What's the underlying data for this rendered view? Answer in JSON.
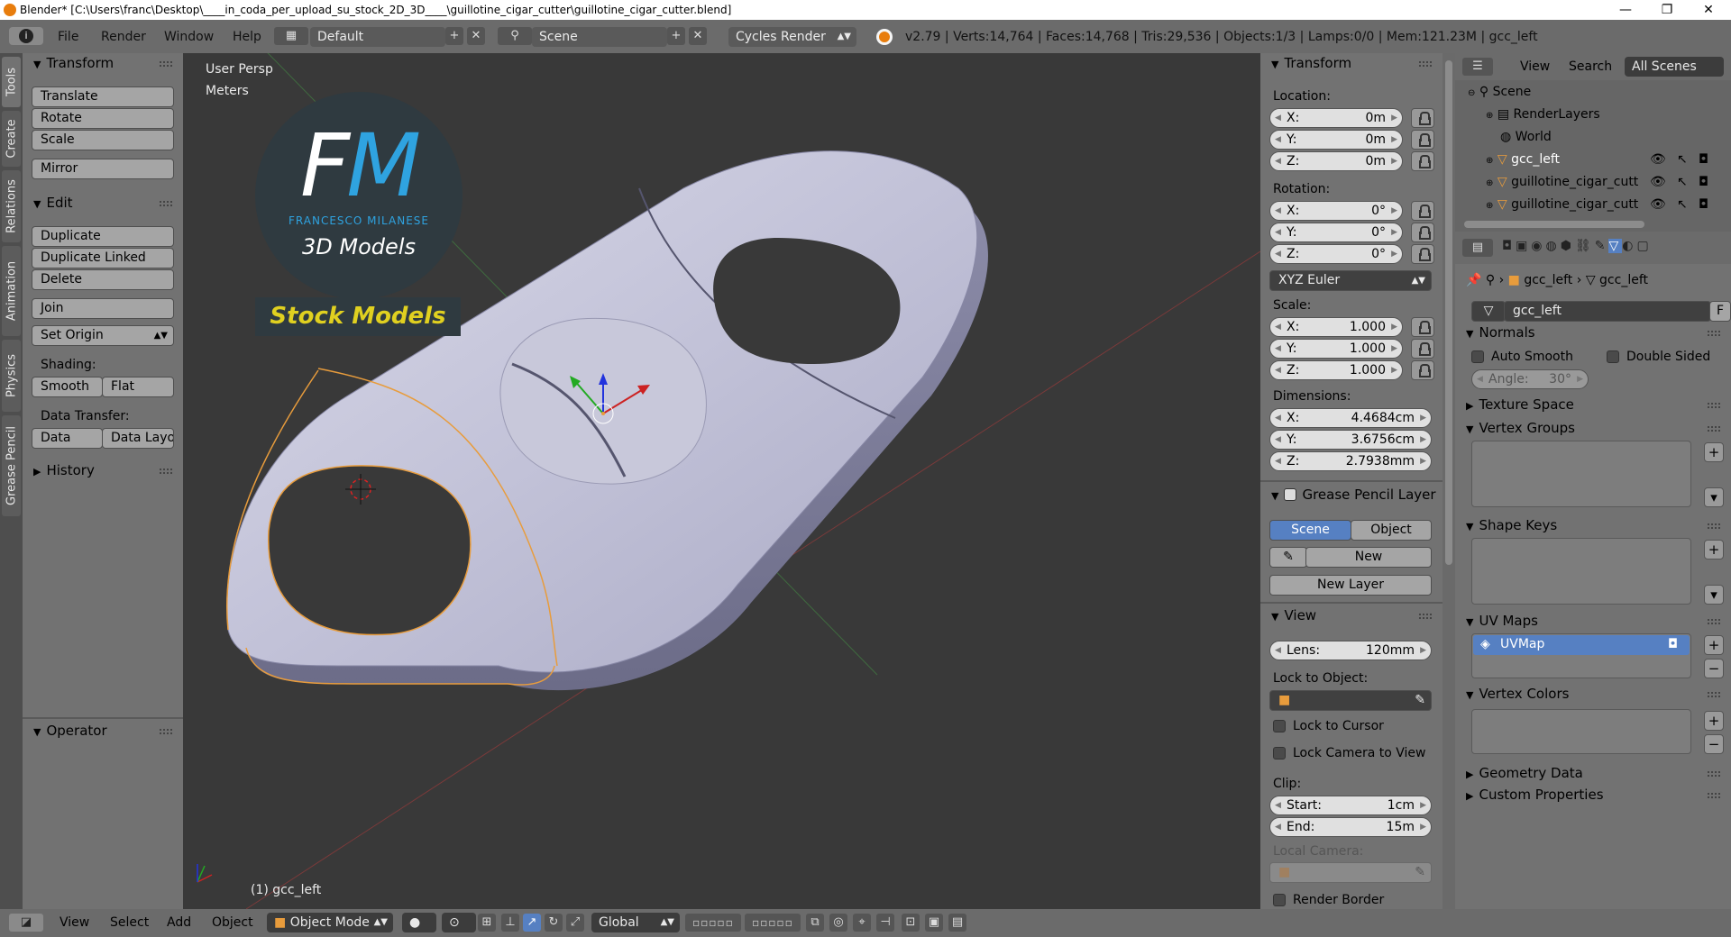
{
  "titlebar": {
    "title": "Blender* [C:\\Users\\franc\\Desktop\\____in_coda_per_upload_su_stock_2D_3D____\\guillotine_cigar_cutter\\guillotine_cigar_cutter.blend]",
    "minimize": "—",
    "maximize": "❐",
    "close": "✕"
  },
  "menubar": {
    "info_icon": "i",
    "file": "File",
    "render": "Render",
    "window": "Window",
    "help": "Help",
    "screen_layout": "Default",
    "scene": "Scene",
    "engine": "Cycles Render",
    "stats": "v2.79 | Verts:14,764 | Faces:14,768 | Tris:29,536 | Objects:1/3 | Lamps:0/0 | Mem:121.23M | gcc_left"
  },
  "tabs": [
    "Tools",
    "Create",
    "Relations",
    "Animation",
    "Physics",
    "Grease Pencil"
  ],
  "toolshelf": {
    "transform_title": "Transform",
    "translate": "Translate",
    "rotate": "Rotate",
    "scale": "Scale",
    "mirror": "Mirror",
    "edit_title": "Edit",
    "duplicate": "Duplicate",
    "duplicate_linked": "Duplicate Linked",
    "delete": "Delete",
    "join": "Join",
    "set_origin": "Set Origin",
    "shading_label": "Shading:",
    "smooth": "Smooth",
    "flat": "Flat",
    "data_transfer_label": "Data Transfer:",
    "data": "Data",
    "data_layout": "Data Layo",
    "history_title": "History",
    "operator_title": "Operator"
  },
  "viewport": {
    "view_name": "User Persp",
    "units": "Meters",
    "object_label": "(1) gcc_left",
    "logo_letters": "FM",
    "logo_name": "FRANCESCO MILANESE",
    "logo_sub": "3D Models",
    "stock_models": "Stock Models"
  },
  "npanel": {
    "transform_title": "Transform",
    "location_label": "Location:",
    "location": [
      {
        "k": "X:",
        "v": "0m"
      },
      {
        "k": "Y:",
        "v": "0m"
      },
      {
        "k": "Z:",
        "v": "0m"
      }
    ],
    "rotation_label": "Rotation:",
    "rotation": [
      {
        "k": "X:",
        "v": "0°"
      },
      {
        "k": "Y:",
        "v": "0°"
      },
      {
        "k": "Z:",
        "v": "0°"
      }
    ],
    "rotation_mode": "XYZ Euler",
    "scale_label": "Scale:",
    "scale": [
      {
        "k": "X:",
        "v": "1.000"
      },
      {
        "k": "Y:",
        "v": "1.000"
      },
      {
        "k": "Z:",
        "v": "1.000"
      }
    ],
    "dimensions_label": "Dimensions:",
    "dimensions": [
      {
        "k": "X:",
        "v": "4.4684cm"
      },
      {
        "k": "Y:",
        "v": "3.6756cm"
      },
      {
        "k": "Z:",
        "v": "2.7938mm"
      }
    ],
    "grease_title": "Grease Pencil Layer",
    "scene_btn": "Scene",
    "object_btn": "Object",
    "new_btn": "New",
    "new_layer_btn": "New Layer",
    "view_title": "View",
    "lens_key": "Lens:",
    "lens_val": "120mm",
    "lock_to_object": "Lock to Object:",
    "lock_to_cursor": "Lock to Cursor",
    "lock_camera": "Lock Camera to View",
    "clip_label": "Clip:",
    "clip_start_key": "Start:",
    "clip_start_val": "1cm",
    "clip_end_key": "End:",
    "clip_end_val": "15m",
    "local_camera": "Local Camera:",
    "render_border": "Render Border"
  },
  "outliner": {
    "view": "View",
    "search": "Search",
    "all_scenes": "All Scenes",
    "items": [
      "Scene",
      "RenderLayers",
      "World",
      "gcc_left",
      "guillotine_cigar_cutt",
      "guillotine_cigar_cutt"
    ]
  },
  "props": {
    "breadcrumb_obj": "gcc_left",
    "breadcrumb_mesh": "gcc_left",
    "mesh_name": "gcc_left",
    "fake_user": "F",
    "normals_title": "Normals",
    "auto_smooth": "Auto Smooth",
    "double_sided": "Double Sided",
    "angle_key": "Angle:",
    "angle_val": "30°",
    "texture_space": "Texture Space",
    "vertex_groups": "Vertex Groups",
    "shape_keys": "Shape Keys",
    "uv_maps": "UV Maps",
    "uvmap_name": "UVMap",
    "vertex_colors": "Vertex Colors",
    "geometry_data": "Geometry Data",
    "custom_properties": "Custom Properties"
  },
  "bottombar": {
    "view": "View",
    "select": "Select",
    "add": "Add",
    "object": "Object",
    "mode": "Object Mode",
    "orientation": "Global"
  },
  "colors": {
    "selected_blue": "#5680c2",
    "object_orange": "#e89c3c",
    "logo_blue": "#2fa3e0",
    "stock_yellow": "#e0d020"
  }
}
